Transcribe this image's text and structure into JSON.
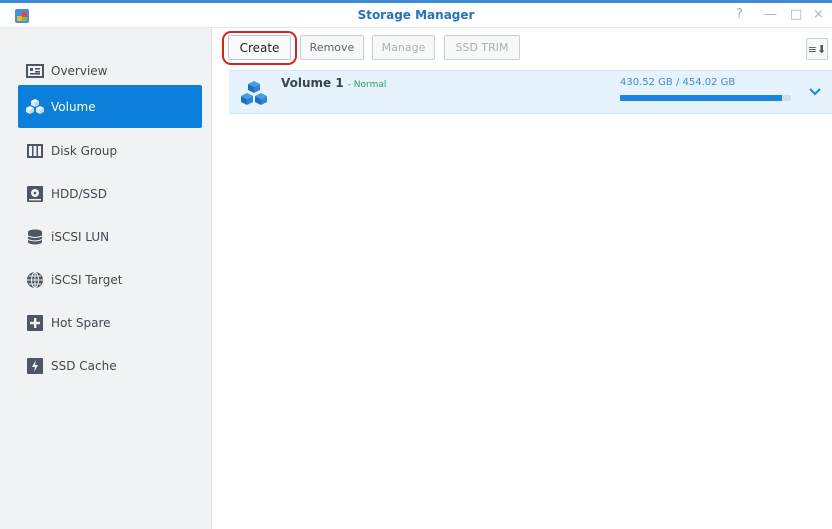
{
  "window": {
    "title": "Storage Manager",
    "controls": {
      "help": "?",
      "minimize": "—",
      "maximize": "□",
      "close": "×"
    }
  },
  "sidebar": {
    "items": [
      {
        "label": "Overview",
        "icon": "overview-icon",
        "active": false
      },
      {
        "label": "Volume",
        "icon": "volume-icon",
        "active": true
      },
      {
        "label": "Disk Group",
        "icon": "disk-group-icon",
        "active": false
      },
      {
        "label": "HDD/SSD",
        "icon": "hdd-icon",
        "active": false
      },
      {
        "label": "iSCSI LUN",
        "icon": "iscsi-lun-icon",
        "active": false
      },
      {
        "label": "iSCSI Target",
        "icon": "iscsi-target-icon",
        "active": false
      },
      {
        "label": "Hot Spare",
        "icon": "hot-spare-icon",
        "active": false
      },
      {
        "label": "SSD Cache",
        "icon": "ssd-cache-icon",
        "active": false
      }
    ]
  },
  "toolbar": {
    "create_label": "Create",
    "remove_label": "Remove",
    "manage_label": "Manage",
    "ssd_trim_label": "SSD TRIM",
    "sort_icon": "≡⬇"
  },
  "volumes": [
    {
      "name": "Volume 1",
      "status": "- Normal",
      "usage": "430.52 GB / 454.02 GB",
      "used_fraction": 0.948
    }
  ],
  "colors": {
    "accent": "#0b7fd9",
    "title": "#2673b9",
    "status_ok": "#2e9e5a",
    "highlight": "#d32222"
  }
}
